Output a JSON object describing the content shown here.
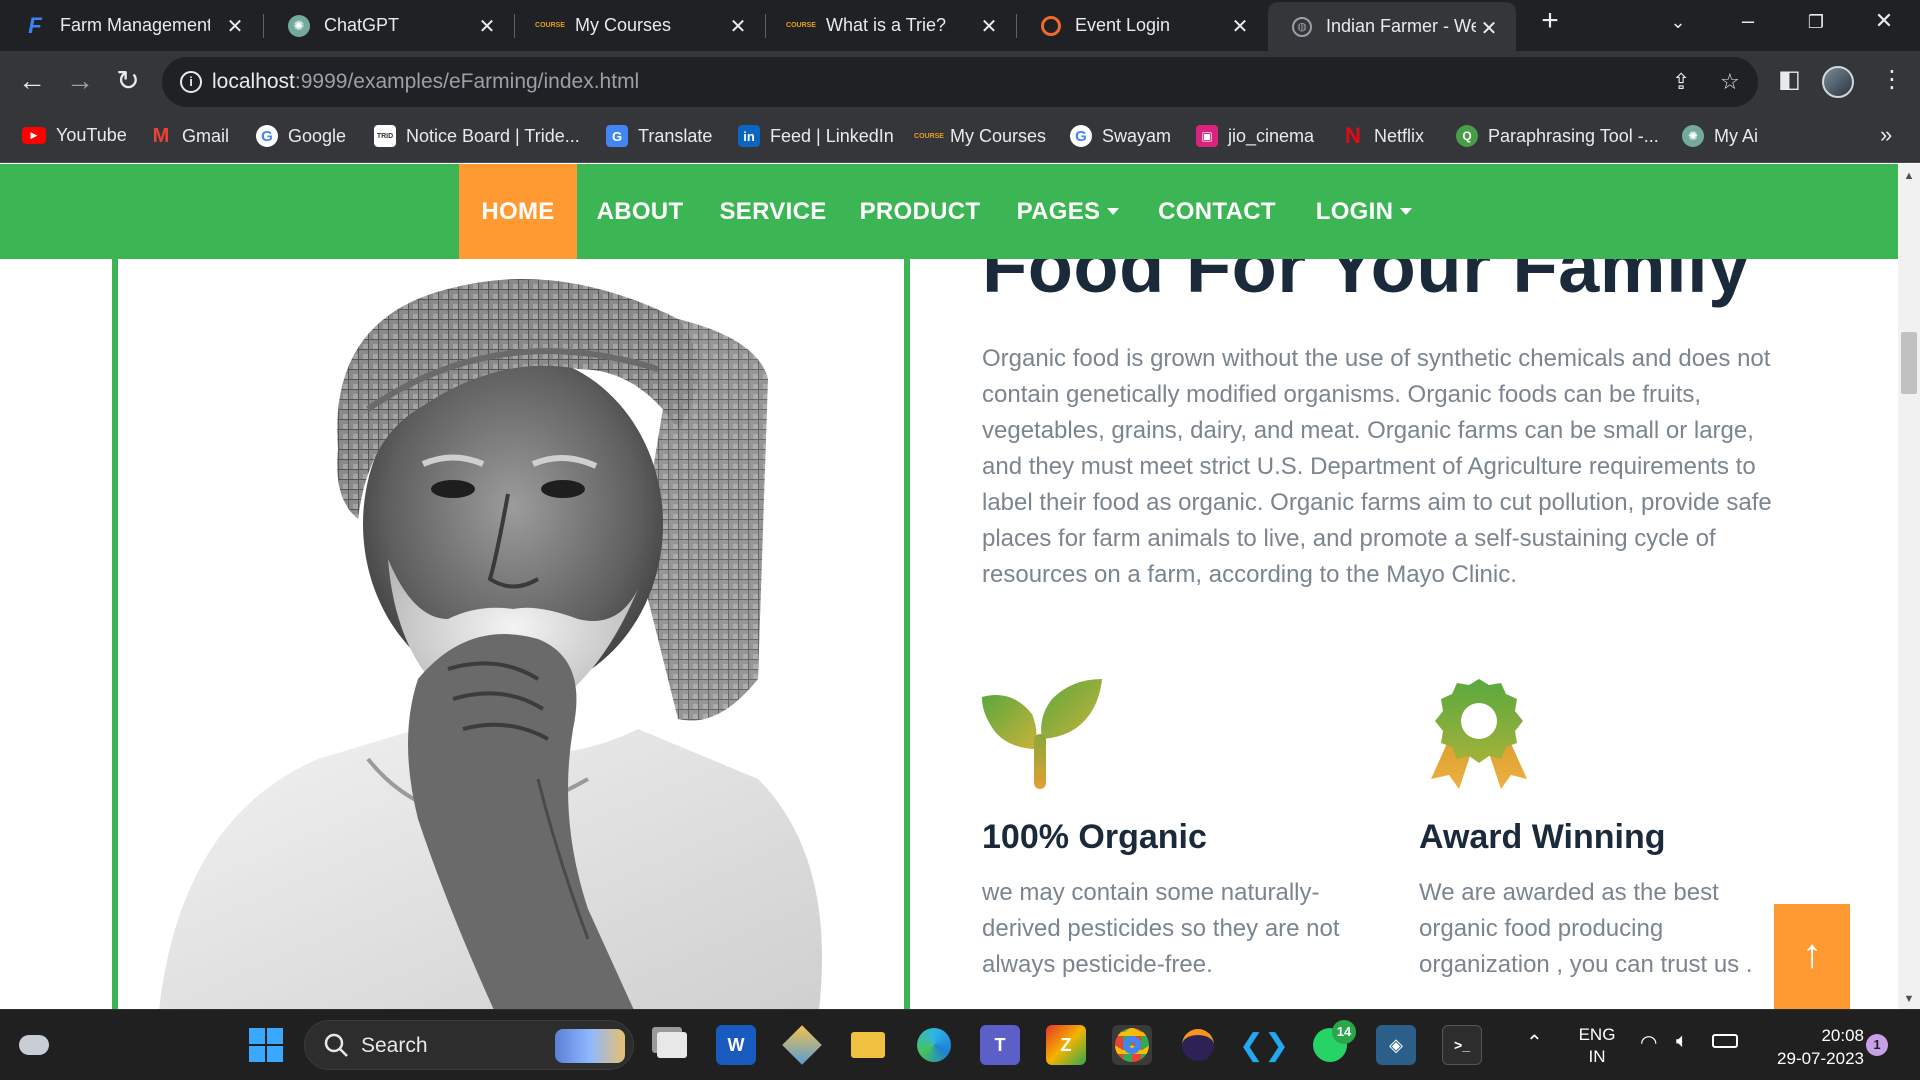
{
  "browser": {
    "tabs": [
      {
        "title": "Farm Management",
        "icon": "F"
      },
      {
        "title": "ChatGPT",
        "icon": "openai"
      },
      {
        "title": "My Courses",
        "icon": "coursera"
      },
      {
        "title": "What is a Trie?",
        "icon": "coursera"
      },
      {
        "title": "Event Login",
        "icon": "event"
      },
      {
        "title": "Indian Farmer - We",
        "icon": "globe",
        "active": true
      }
    ],
    "new_tab_label": "+",
    "url_host": "localhost",
    "url_rest": ":9999/examples/eFarming/index.html",
    "bookmarks": [
      {
        "label": "YouTube",
        "icon": "youtube-icon",
        "color": "#ff0000"
      },
      {
        "label": "Gmail",
        "icon": "gmail-icon",
        "color": "#ea4335"
      },
      {
        "label": "Google",
        "icon": "google-icon",
        "color": "#4285f4"
      },
      {
        "label": "Notice Board | Tride...",
        "icon": "trident-icon",
        "color": "#888888"
      },
      {
        "label": "Translate",
        "icon": "translate-icon",
        "color": "#4285f4"
      },
      {
        "label": "Feed | LinkedIn",
        "icon": "linkedin-icon",
        "color": "#0a66c2"
      },
      {
        "label": "My Courses",
        "icon": "coursera-icon",
        "color": "#e0a020"
      },
      {
        "label": "Swayam",
        "icon": "google-icon",
        "color": "#4285f4"
      },
      {
        "label": "jio_cinema",
        "icon": "jiocinema-icon",
        "color": "#d6247f"
      },
      {
        "label": "Netflix",
        "icon": "netflix-icon",
        "color": "#e50914"
      },
      {
        "label": "Paraphrasing Tool -...",
        "icon": "quillbot-icon",
        "color": "#499d4a"
      },
      {
        "label": "My Ai",
        "icon": "openai-icon",
        "color": "#74aa9c"
      }
    ],
    "more_bookmarks": "»"
  },
  "site": {
    "nav": [
      {
        "label": "HOME",
        "active": true
      },
      {
        "label": "ABOUT"
      },
      {
        "label": "SERVICE"
      },
      {
        "label": "PRODUCT"
      },
      {
        "label": "PAGES",
        "dropdown": true
      },
      {
        "label": "CONTACT"
      },
      {
        "label": "LOGIN",
        "dropdown": true
      }
    ],
    "heading_partial": "Food For Your Family",
    "paragraph": "Organic food is grown without the use of synthetic chemicals and does not contain genetically modified organisms. Organic foods can be fruits, vegetables, grains, dairy, and meat. Organic farms can be small or large, and they must meet strict U.S. Department of Agriculture requirements to label their food as organic. Organic farms aim to cut pollution, provide safe places for farm animals to live, and promote a self-sustaining cycle of resources on a farm, according to the Mayo Clinic.",
    "features": [
      {
        "title": "100% Organic",
        "text": "we may contain some naturally-derived pesticides so they are not always pesticide-free.",
        "icon": "sprout-icon"
      },
      {
        "title": "Award Winning",
        "text": "We are awarded as the best organic food producing organization , you can trust us .",
        "icon": "award-icon"
      }
    ],
    "to_top": "↑",
    "colors": {
      "primary": "#3cb554",
      "accent": "#ff9a33",
      "heading": "#1a2a3a",
      "text": "#7a8590"
    }
  },
  "taskbar": {
    "search_label": "Search",
    "whatsapp_badge": "14",
    "lang_line1": "ENG",
    "lang_line2": "IN",
    "time": "20:08",
    "date": "29-07-2023",
    "notification_count": "1"
  }
}
